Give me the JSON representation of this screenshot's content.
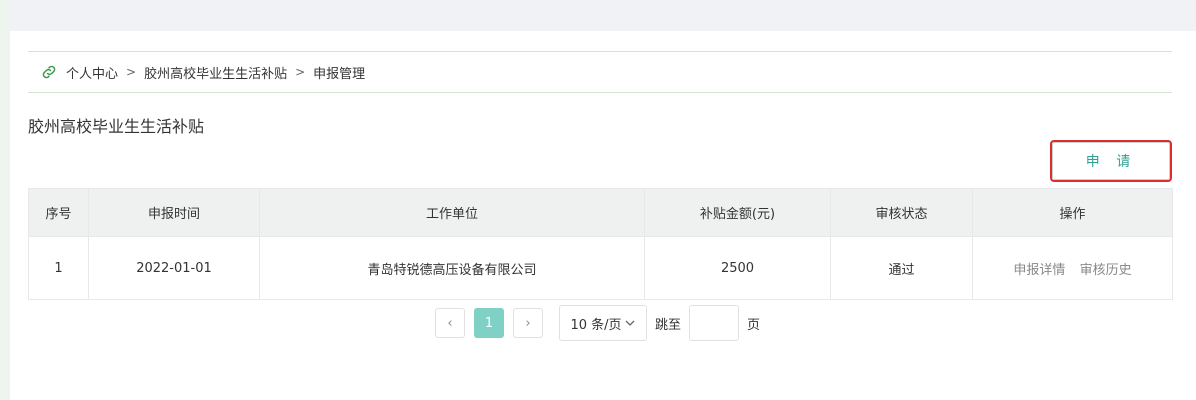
{
  "breadcrumb": {
    "items": [
      "个人中心",
      "胶州高校毕业生生活补贴",
      "申报管理"
    ],
    "separator": ">"
  },
  "page_title": "胶州高校毕业生生活补贴",
  "apply_button": "申 请",
  "table": {
    "headers": [
      "序号",
      "申报时间",
      "工作单位",
      "补贴金额(元)",
      "审核状态",
      "操作"
    ],
    "rows": [
      {
        "index": "1",
        "date": "2022-01-01",
        "employer": "青岛特锐德高压设备有限公司",
        "amount": "2500",
        "status": "通过",
        "actions": [
          "申报详情",
          "审核历史"
        ]
      }
    ]
  },
  "pagination": {
    "prev": "‹",
    "current_page": "1",
    "next": "›",
    "page_size": "10 条/页",
    "jump_label": "跳至",
    "jump_value": "",
    "page_suffix": "页"
  },
  "colors": {
    "accent": "#2fa092",
    "active_page": "#7fd0c5",
    "highlight_border": "#d9302b"
  }
}
